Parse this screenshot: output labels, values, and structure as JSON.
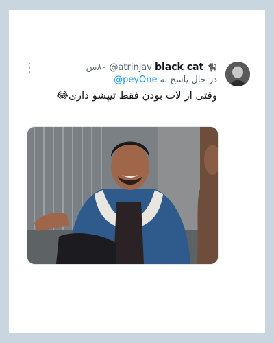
{
  "tweet": {
    "display_name": "black cat",
    "name_icon": "cat-icon",
    "handle": "@atrinjav",
    "separator": "·",
    "time": "۸۰س",
    "reply_prefix": "در حال پاسخ به",
    "reply_mention": "@peyOne",
    "text": "وقتی از لات بودن فقط تیپشو داری😂",
    "more_icon": "more-vertical-icon",
    "media_description_icon": "photo"
  },
  "colors": {
    "background": "#c9d6df",
    "card": "#ffffff",
    "link": "#1d9bf0",
    "secondary": "#536471",
    "primary_text": "#0f1419"
  }
}
